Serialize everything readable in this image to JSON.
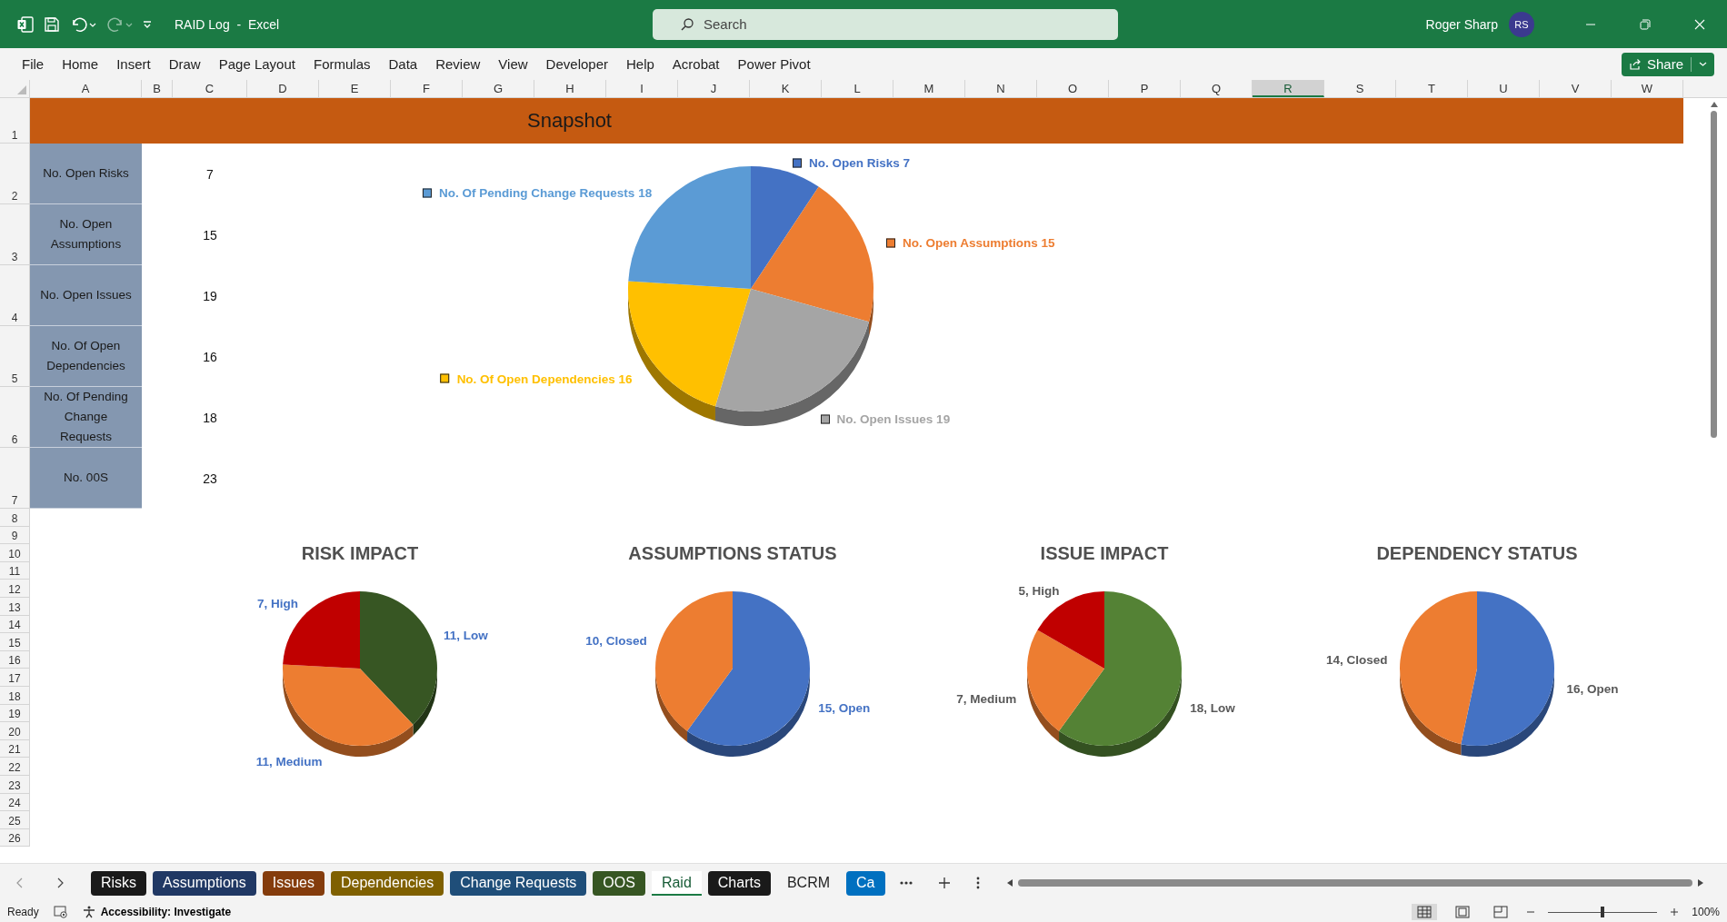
{
  "title_bar": {
    "document_title": "RAID Log  -  Excel",
    "search": {
      "placeholder": "Search"
    },
    "user": {
      "name": "Roger Sharp",
      "initials": "RS"
    }
  },
  "ribbon": {
    "menu": [
      "File",
      "Home",
      "Insert",
      "Draw",
      "Page Layout",
      "Formulas",
      "Data",
      "Review",
      "View",
      "Developer",
      "Help",
      "Acrobat",
      "Power Pivot"
    ],
    "share": "Share"
  },
  "sheet": {
    "columns": [
      {
        "label": "A",
        "selected": false
      },
      {
        "label": "B",
        "selected": false
      },
      {
        "label": "C",
        "selected": false
      },
      {
        "label": "D",
        "selected": false
      },
      {
        "label": "E",
        "selected": false
      },
      {
        "label": "F",
        "selected": false
      },
      {
        "label": "G",
        "selected": false
      },
      {
        "label": "H",
        "selected": false
      },
      {
        "label": "I",
        "selected": false
      },
      {
        "label": "J",
        "selected": false
      },
      {
        "label": "K",
        "selected": false
      },
      {
        "label": "L",
        "selected": false
      },
      {
        "label": "M",
        "selected": false
      },
      {
        "label": "N",
        "selected": false
      },
      {
        "label": "O",
        "selected": false
      },
      {
        "label": "P",
        "selected": false
      },
      {
        "label": "Q",
        "selected": false
      },
      {
        "label": "R",
        "selected": true
      },
      {
        "label": "S",
        "selected": false
      },
      {
        "label": "T",
        "selected": false
      },
      {
        "label": "U",
        "selected": false
      },
      {
        "label": "V",
        "selected": false
      },
      {
        "label": "W",
        "selected": false
      }
    ],
    "rows": [
      "1",
      "2",
      "3",
      "4",
      "5",
      "6",
      "7",
      "8",
      "9",
      "10",
      "11",
      "12",
      "13",
      "14",
      "15",
      "16",
      "17",
      "18",
      "19",
      "20",
      "21",
      "22",
      "23",
      "24",
      "25",
      "26"
    ],
    "title": "Snapshot",
    "stats": [
      {
        "label": "No. Open Risks",
        "value": "7"
      },
      {
        "label": "No. Open Assumptions",
        "value": "15"
      },
      {
        "label": "No. Open Issues",
        "value": "19"
      },
      {
        "label": "No. Of Open Dependencies",
        "value": "16"
      },
      {
        "label": "No. Of Pending Change Requests",
        "value": "18"
      },
      {
        "label": "No. 00S",
        "value": "23"
      }
    ],
    "snapshot_chart": {
      "chart_data": {
        "type": "pie",
        "values": [
          7,
          15,
          19,
          16,
          18
        ],
        "colors": [
          "#4472c4",
          "#ed7d31",
          "#a5a5a5",
          "#ffc000",
          "#5b9bd5"
        ],
        "value_labels": [
          "No. Open Risks 7",
          "No. Open Assumptions 15",
          "No. Open Issues 19",
          "No. Of Open Dependencies 16",
          "No. Of Pending Change Requests 18"
        ]
      }
    },
    "small_charts": [
      {
        "chart_data": {
          "type": "pie",
          "title": "RISK IMPACT",
          "values": [
            11,
            11,
            7
          ],
          "colors": [
            "#375623",
            "#ed7d31",
            "#c00000"
          ],
          "value_labels": [
            "11, Low",
            "11, Medium",
            "7, High"
          ]
        }
      },
      {
        "chart_data": {
          "type": "pie",
          "title": "ASSUMPTIONS STATUS",
          "values": [
            15,
            10
          ],
          "colors": [
            "#4472c4",
            "#ed7d31"
          ],
          "value_labels": [
            "15, Open",
            "10, Closed"
          ]
        }
      },
      {
        "chart_data": {
          "type": "pie",
          "title": "ISSUE IMPACT",
          "values": [
            18,
            7,
            5
          ],
          "colors": [
            "#548235",
            "#ed7d31",
            "#c00000"
          ],
          "value_labels": [
            "18, Low",
            "7, Medium",
            "5, High"
          ]
        }
      },
      {
        "chart_data": {
          "type": "pie",
          "title": "DEPENDENCY STATUS",
          "values": [
            16,
            14
          ],
          "colors": [
            "#4472c4",
            "#ed7d31"
          ],
          "value_labels": [
            "16, Open",
            "14, Closed"
          ]
        }
      }
    ]
  },
  "sheet_tabs": [
    {
      "label": "Risks",
      "selected": false,
      "color": "#1a1a1a"
    },
    {
      "label": "Assumptions",
      "selected": false,
      "color": "#203864"
    },
    {
      "label": "Issues",
      "selected": false,
      "color": "#843c0c"
    },
    {
      "label": "Dependencies",
      "selected": false,
      "color": "#7f6000"
    },
    {
      "label": "Change Requests",
      "selected": false,
      "color": "#1f4e79"
    },
    {
      "label": "OOS",
      "selected": false,
      "color": "#375623"
    },
    {
      "label": "Raid",
      "selected": true
    },
    {
      "label": "Charts",
      "selected": false,
      "color": "#1a1a1a"
    },
    {
      "label": "BCRM",
      "selected": false
    },
    {
      "label": "Ca",
      "selected": false,
      "color": "#0070c0"
    }
  ],
  "status_bar": {
    "status": "Ready",
    "accessibility": "Accessibility: Investigate",
    "zoom": {
      "level": 0.5,
      "reading": "100%"
    }
  }
}
